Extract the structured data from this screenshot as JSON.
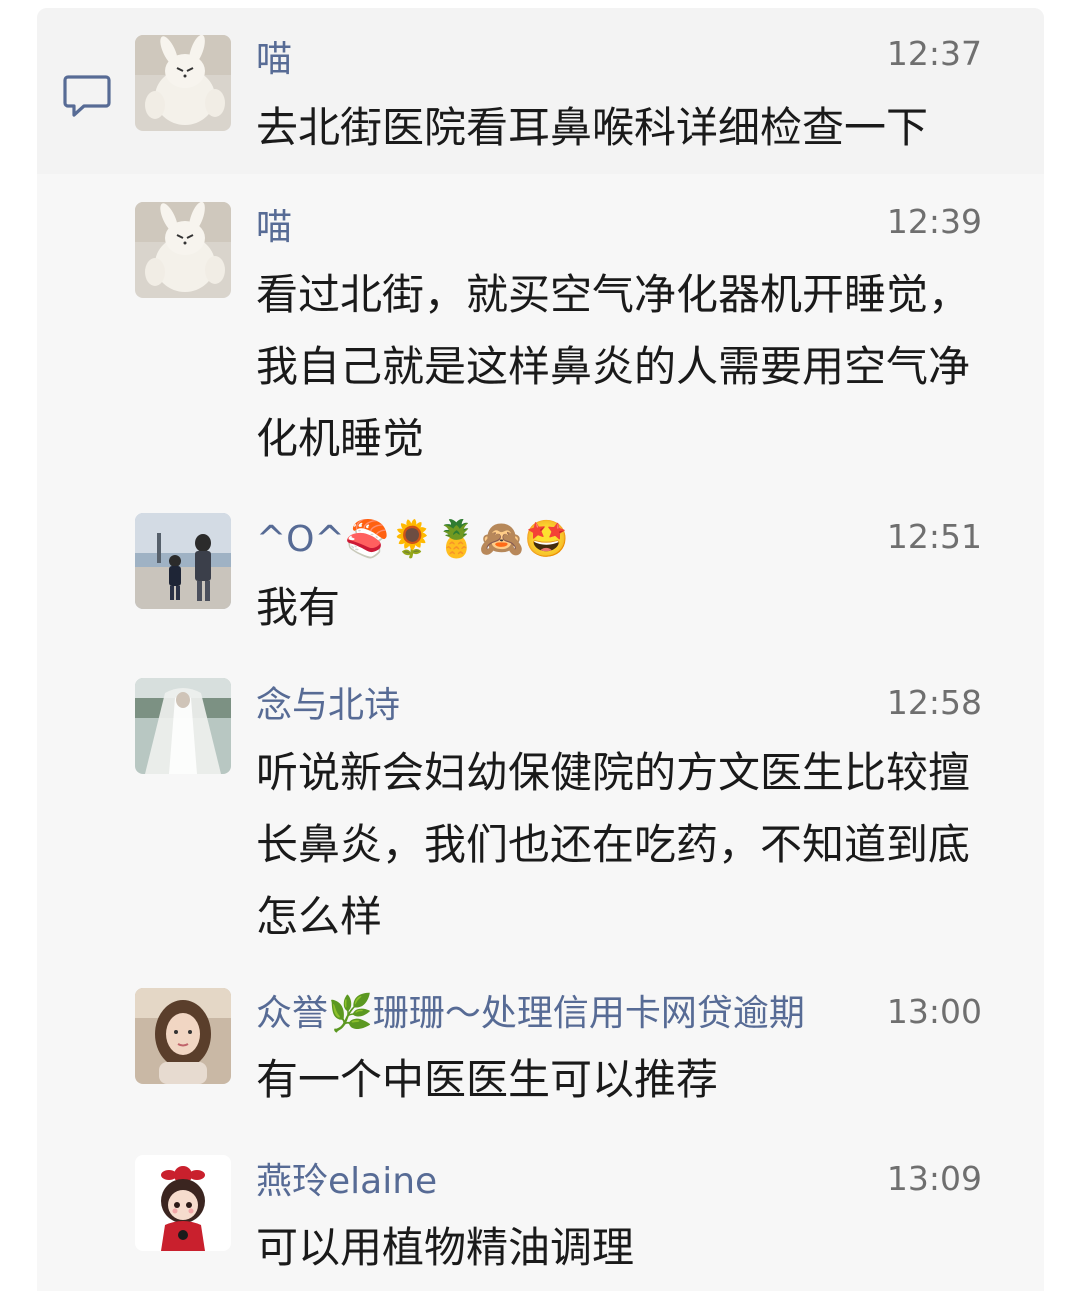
{
  "messages": [
    {
      "name": "喵",
      "time": "12:37",
      "text": "去北街医院看耳鼻喉科详细检查一下",
      "avatar_icon": "plush-bunny-avatar"
    },
    {
      "name": "喵",
      "time": "12:39",
      "text": "看过北街，就买空气净化器机开睡觉，我自己就是这样鼻炎的人需要用空气净化机睡觉",
      "avatar_icon": "plush-bunny-avatar"
    },
    {
      "name": "^O^🍣🌻🍍🙈🤩",
      "time": "12:51",
      "text": "我有",
      "avatar_icon": "seaside-family-photo-avatar"
    },
    {
      "name": "念与北诗",
      "time": "12:58",
      "text": "听说新会妇幼保健院的方文医生比较擅长鼻炎，我们也还在吃药，不知道到底怎么样",
      "avatar_icon": "bridal-veil-avatar"
    },
    {
      "name": "众誉🌿珊珊～处理信用卡网贷逾期",
      "time": "13:00",
      "text": "有一个中医医生可以推荐",
      "avatar_icon": "woman-portrait-avatar"
    },
    {
      "name": "燕玲elaine",
      "time": "13:09",
      "text": "可以用植物精油调理",
      "avatar_icon": "cartoon-girl-avatar"
    }
  ],
  "colors": {
    "name": "#576b95",
    "time": "#6f6f6f",
    "text": "#1a1a1a",
    "panel": "#f7f7f7",
    "icon": "#576b95"
  },
  "side_icon": "comment-bubble-icon"
}
